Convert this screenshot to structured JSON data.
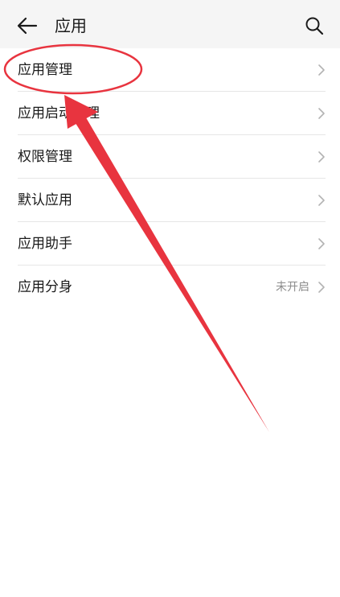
{
  "header": {
    "title": "应用",
    "back_icon": "back-arrow-icon",
    "search_icon": "search-icon"
  },
  "menu": {
    "items": [
      {
        "label": "应用管理",
        "value": ""
      },
      {
        "label": "应用启动管理",
        "value": ""
      },
      {
        "label": "权限管理",
        "value": ""
      },
      {
        "label": "默认应用",
        "value": ""
      },
      {
        "label": "应用助手",
        "value": ""
      },
      {
        "label": "应用分身",
        "value": "未开启"
      }
    ]
  },
  "annotation": {
    "color": "#e8343f",
    "highlight": "ellipse around 应用管理 with arrow pointing to it"
  }
}
